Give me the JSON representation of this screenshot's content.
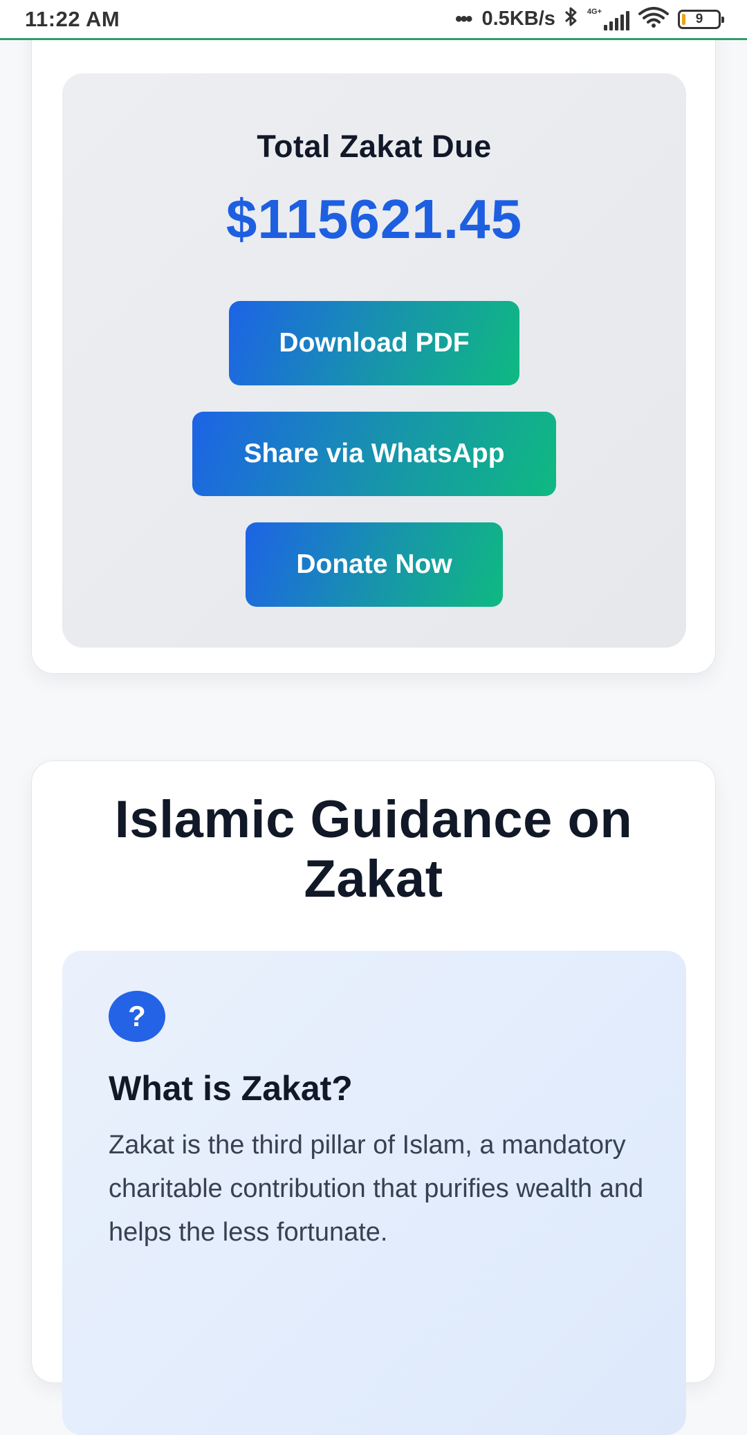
{
  "status_bar": {
    "time": "11:22 AM",
    "dots": "•••",
    "net_speed": "0.5KB/s",
    "bluetooth_icon": "bluetooth-icon",
    "network_label": "4G+",
    "wifi_icon": "wifi-icon",
    "battery_level": "9"
  },
  "zakat_summary": {
    "title": "Total Zakat Due",
    "amount": "$115621.45",
    "amount_color": "#1d5fe0",
    "buttons": {
      "download_pdf": "Download PDF",
      "share_whatsapp": "Share via WhatsApp",
      "donate_now": "Donate Now"
    },
    "button_gradient": [
      "#1d63e6",
      "#0fb981"
    ]
  },
  "guidance": {
    "title": "Islamic Guidance on Zakat",
    "card": {
      "icon": "question-icon",
      "icon_glyph": "?",
      "title": "What is Zakat?",
      "text": "Zakat is the third pillar of Islam, a mandatory charitable contribution that purifies wealth and helps the less fortunate."
    }
  }
}
